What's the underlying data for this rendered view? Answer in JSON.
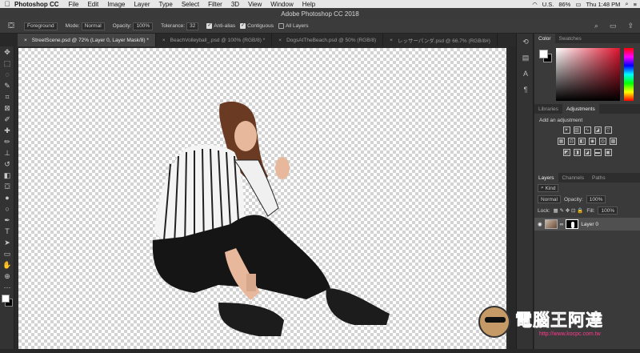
{
  "menubar": {
    "apple": "",
    "app": "Photoshop CC",
    "items": [
      "File",
      "Edit",
      "Image",
      "Layer",
      "Type",
      "Select",
      "Filter",
      "3D",
      "View",
      "Window",
      "Help"
    ],
    "flag": "U.S.",
    "battery": "86%",
    "clock": "Thu 1:48 PM"
  },
  "titlebar": {
    "title": "Adobe Photoshop CC 2018"
  },
  "options": {
    "preset": "Foreground",
    "mode_label": "Mode:",
    "mode_value": "Normal",
    "opacity_label": "Opacity:",
    "opacity_value": "100%",
    "tolerance_label": "Tolerance:",
    "tolerance_value": "32",
    "antialias": "Anti-alias",
    "contiguous": "Contiguous",
    "all_layers": "All Layers"
  },
  "tabs": [
    "StreetScene.psd @ 72% (Layer 0, Layer Mask/8) *",
    "BeachVolleyball_.psd @ 100% (RGB/8) *",
    "DogsAtTheBeach.psd @ 50% (RGB/8)",
    "レッサーパンダ.psd @ 66.7% (RGB/8#)"
  ],
  "panels": {
    "color_tab": "Color",
    "swatches_tab": "Swatches",
    "libraries_tab": "Libraries",
    "adjustments_tab": "Adjustments",
    "add_adjustment": "Add an adjustment",
    "layers_tab": "Layers",
    "channels_tab": "Channels",
    "paths_tab": "Paths",
    "kind": "Kind",
    "blend": "Normal",
    "opacity_label": "Opacity:",
    "opacity_value": "100%",
    "lock_label": "Lock:",
    "fill_label": "Fill:",
    "fill_value": "100%",
    "layer_name": "Layer 0"
  },
  "watermark": {
    "big": "電腦王阿達",
    "url": "http://www.kocpc.com.tw"
  }
}
